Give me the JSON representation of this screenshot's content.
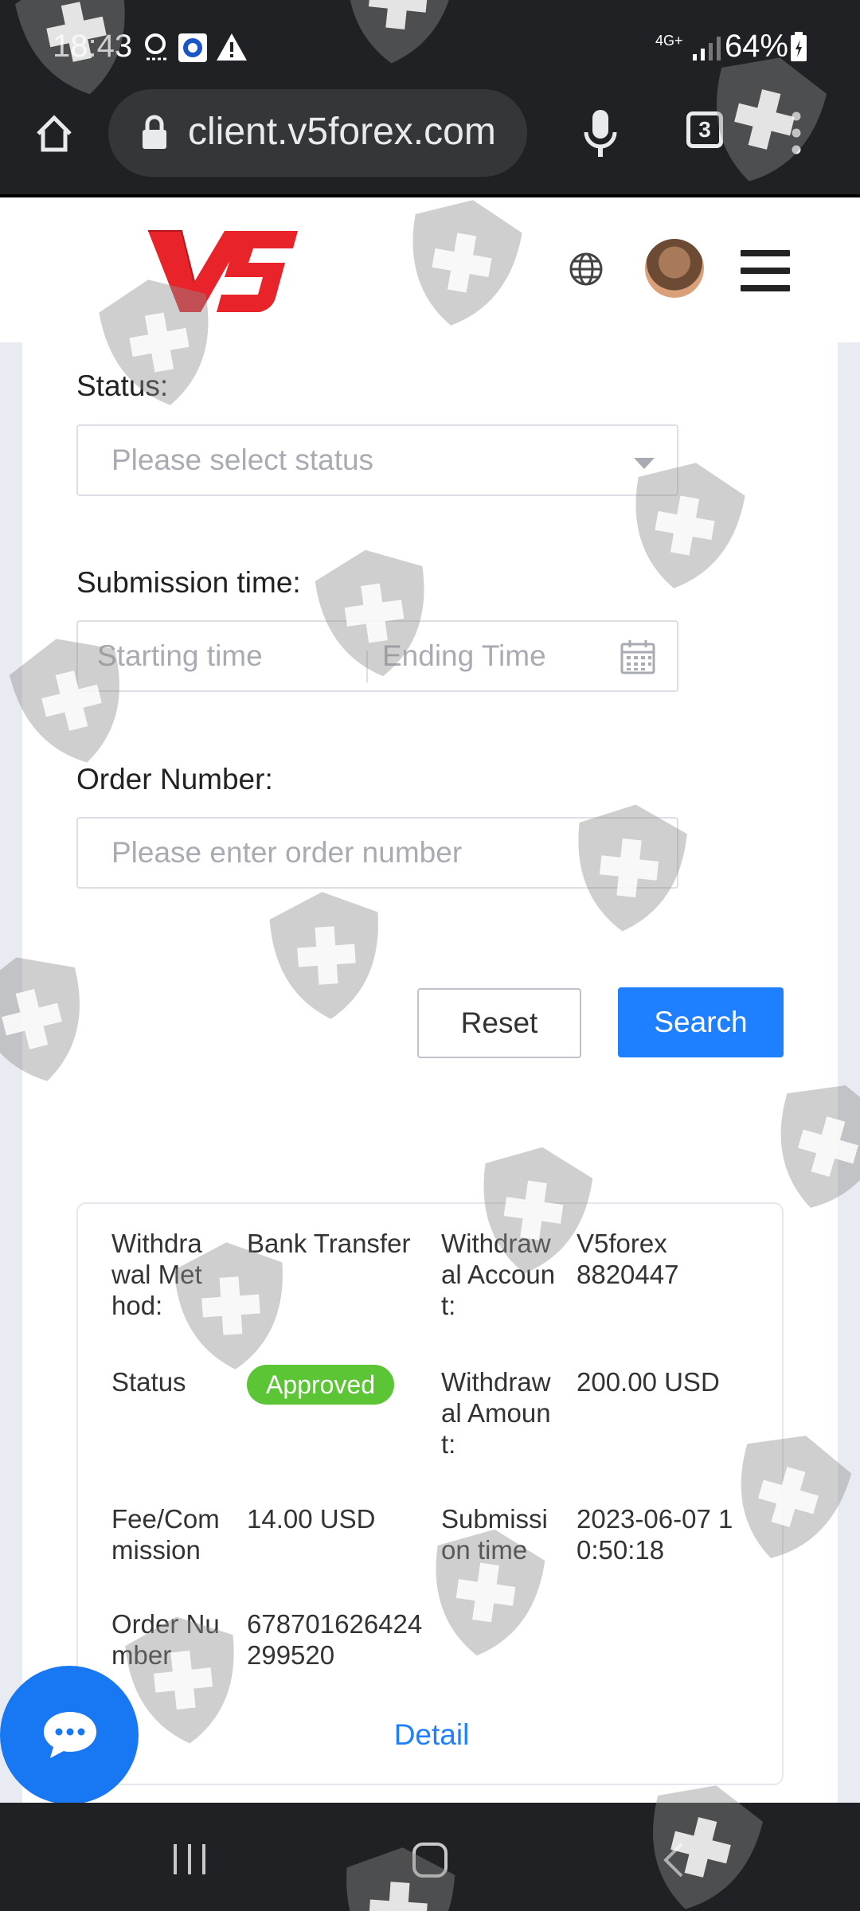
{
  "status_bar": {
    "time": "18:43",
    "network": "4G+",
    "battery": "64%"
  },
  "browser": {
    "url": "client.v5forex.com",
    "tab_count": "3"
  },
  "header": {
    "logo_text": "V5"
  },
  "filters": {
    "status_label": "Status:",
    "status_placeholder": "Please select status",
    "submission_label": "Submission time:",
    "start_placeholder": "Starting time",
    "end_placeholder": "Ending Time",
    "order_label": "Order Number:",
    "order_placeholder": "Please enter order number"
  },
  "buttons": {
    "reset": "Reset",
    "search": "Search"
  },
  "record": {
    "method_label": "Withdrawal Method:",
    "method_value": "Bank Transfer",
    "account_label": "Withdrawal Account:",
    "account_value": "V5forex 8820447",
    "status_label": "Status",
    "status_value": "Approved",
    "amount_label": "Withdrawal Amount:",
    "amount_value": "200.00 USD",
    "fee_label": "Fee/Commission",
    "fee_value": "14.00 USD",
    "time_label": "Submission time",
    "time_value": "2023-06-07 10:50:18",
    "order_label": "Order Number",
    "order_value": "678701626424299520",
    "detail_link": "Detail"
  },
  "colors": {
    "primary": "#1e7fff",
    "approved": "#5cc535",
    "logo_red": "#e8232a",
    "chrome_dark": "#202124"
  },
  "icons": [
    "home-icon",
    "lock-icon",
    "microphone-icon",
    "tabs-icon",
    "more-vert-icon",
    "globe-icon",
    "menu-icon",
    "calendar-icon",
    "chat-icon",
    "recents-icon",
    "home-nav-icon",
    "back-icon"
  ]
}
